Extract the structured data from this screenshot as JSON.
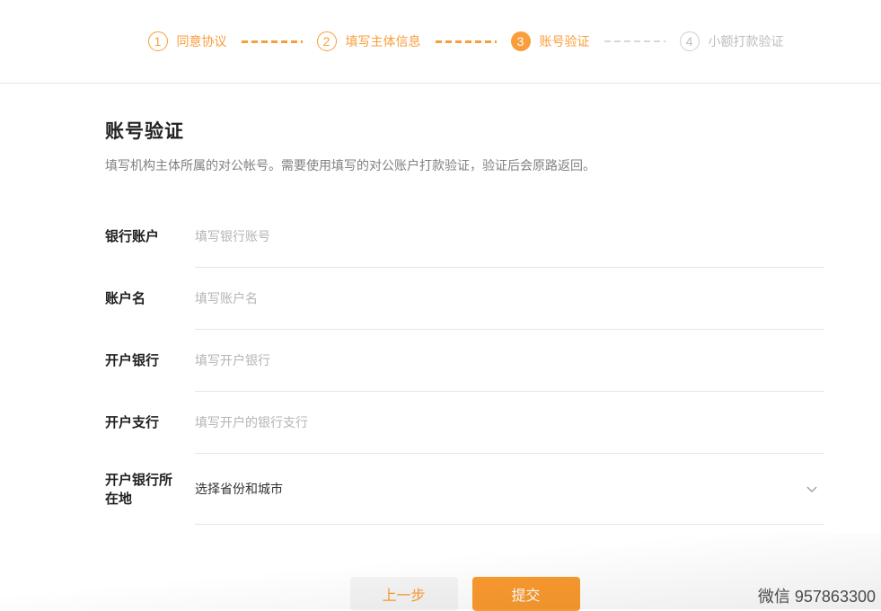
{
  "stepper": {
    "steps": [
      {
        "number": "1",
        "label": "同意协议",
        "state": "done"
      },
      {
        "number": "2",
        "label": "填写主体信息",
        "state": "done"
      },
      {
        "number": "3",
        "label": "账号验证",
        "state": "active"
      },
      {
        "number": "4",
        "label": "小额打款验证",
        "state": "pending"
      }
    ]
  },
  "section": {
    "title": "账号验证",
    "description": "填写机构主体所属的对公帐号。需要使用填写的对公账户打款验证，验证后会原路返回。"
  },
  "form": {
    "fields": [
      {
        "label": "银行账户",
        "placeholder": "填写银行账号",
        "type": "input"
      },
      {
        "label": "账户名",
        "placeholder": "填写账户名",
        "type": "input"
      },
      {
        "label": "开户银行",
        "placeholder": "填写开户银行",
        "type": "input"
      },
      {
        "label": "开户支行",
        "placeholder": "填写开户的银行支行",
        "type": "input"
      },
      {
        "label": "开户银行所在地",
        "value": "选择省份和城市",
        "type": "select"
      }
    ]
  },
  "actions": {
    "previous_label": "上一步",
    "submit_label": "提交"
  },
  "watermark": "微信 957863300",
  "colors": {
    "accent_orange": "#FA9A2E",
    "stepper_orange": "#FA9D3B",
    "pending_gray": "#BDBDBD"
  }
}
